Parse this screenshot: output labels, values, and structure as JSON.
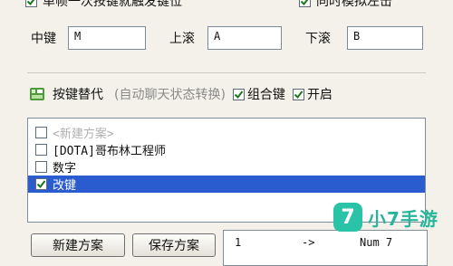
{
  "top_options": {
    "left_label": "单帧一次按键就触发键位",
    "right_label": "同时模拟左击"
  },
  "key_fields": [
    {
      "label": "中键",
      "value": "M"
    },
    {
      "label": "上滚",
      "value": "A"
    },
    {
      "label": "下滚",
      "value": "B"
    }
  ],
  "scheme": {
    "title": "按键替代",
    "subtitle": "(自动聊天状态转换)",
    "combo_label": "组合键",
    "combo_checked": true,
    "enable_label": "开启",
    "enable_checked": true
  },
  "scheme_list": [
    {
      "label": "<新建方案>",
      "checked": false,
      "placeholder": true,
      "selected": false
    },
    {
      "label": "[DOTA]哥布林工程师",
      "checked": false,
      "placeholder": false,
      "selected": false
    },
    {
      "label": "数字",
      "checked": false,
      "placeholder": false,
      "selected": false
    },
    {
      "label": "改键",
      "checked": true,
      "placeholder": false,
      "selected": true
    }
  ],
  "buttons": {
    "new_scheme": "新建方案",
    "save_scheme": "保存方案"
  },
  "mapping": {
    "from": "1",
    "arrow": "->",
    "to": "Num 7"
  },
  "watermark": {
    "icon_glyph": "7",
    "text": "小7手游"
  },
  "colors": {
    "selection": "#2a5bcf",
    "watermark": "#2bc3a7"
  }
}
